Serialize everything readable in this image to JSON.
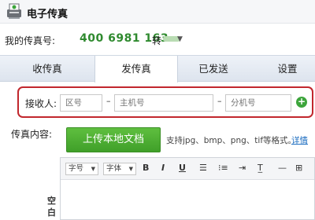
{
  "header": {
    "title": "电子传真"
  },
  "fax": {
    "label": "我的传真号:",
    "number": "400 6981 163",
    "forward_label": "转"
  },
  "tabs": [
    {
      "label": "收传真",
      "active": false
    },
    {
      "label": "发传真",
      "active": true
    },
    {
      "label": "已发送",
      "active": false
    },
    {
      "label": "设置",
      "active": false
    }
  ],
  "recipient": {
    "label": "接收人:",
    "area_placeholder": "区号",
    "main_placeholder": "主机号",
    "ext_placeholder": "分机号",
    "separator": "–"
  },
  "content": {
    "label": "传真内容:",
    "upload_label": "上传本地文档",
    "support_text": "支持jpg、bmp、png、tif等格式。",
    "detail_link": "详情"
  },
  "editor": {
    "font_size_label": "字号",
    "font_family_label": "字体",
    "bold": "B",
    "italic": "I",
    "underline": "U",
    "side_text": "空白"
  },
  "colors": {
    "accent_green": "#3f9f29",
    "number_green": "#2f8a2f",
    "highlight_red": "#c1272d",
    "link_blue": "#1f6fc1"
  }
}
